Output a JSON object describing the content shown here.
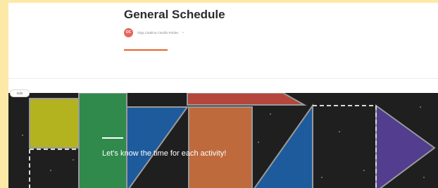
{
  "page": {
    "title": "General Schedule",
    "author": {
      "initials": "OC",
      "name": "Olga Catalina Castillo Robles",
      "avatar_color": "#e8655a"
    },
    "accent_color": "#e8622c"
  },
  "cover": {
    "edit_label": "Edit",
    "tagline": "Let's know the time for each activity!",
    "background_color": "#1f1f1f",
    "shape_colors": {
      "yellow": "#b3b320",
      "green": "#2f8a4c",
      "blue": "#1d5b9c",
      "orange": "#bf6a3c",
      "red": "#b4463b",
      "purple": "#523d8e"
    }
  }
}
